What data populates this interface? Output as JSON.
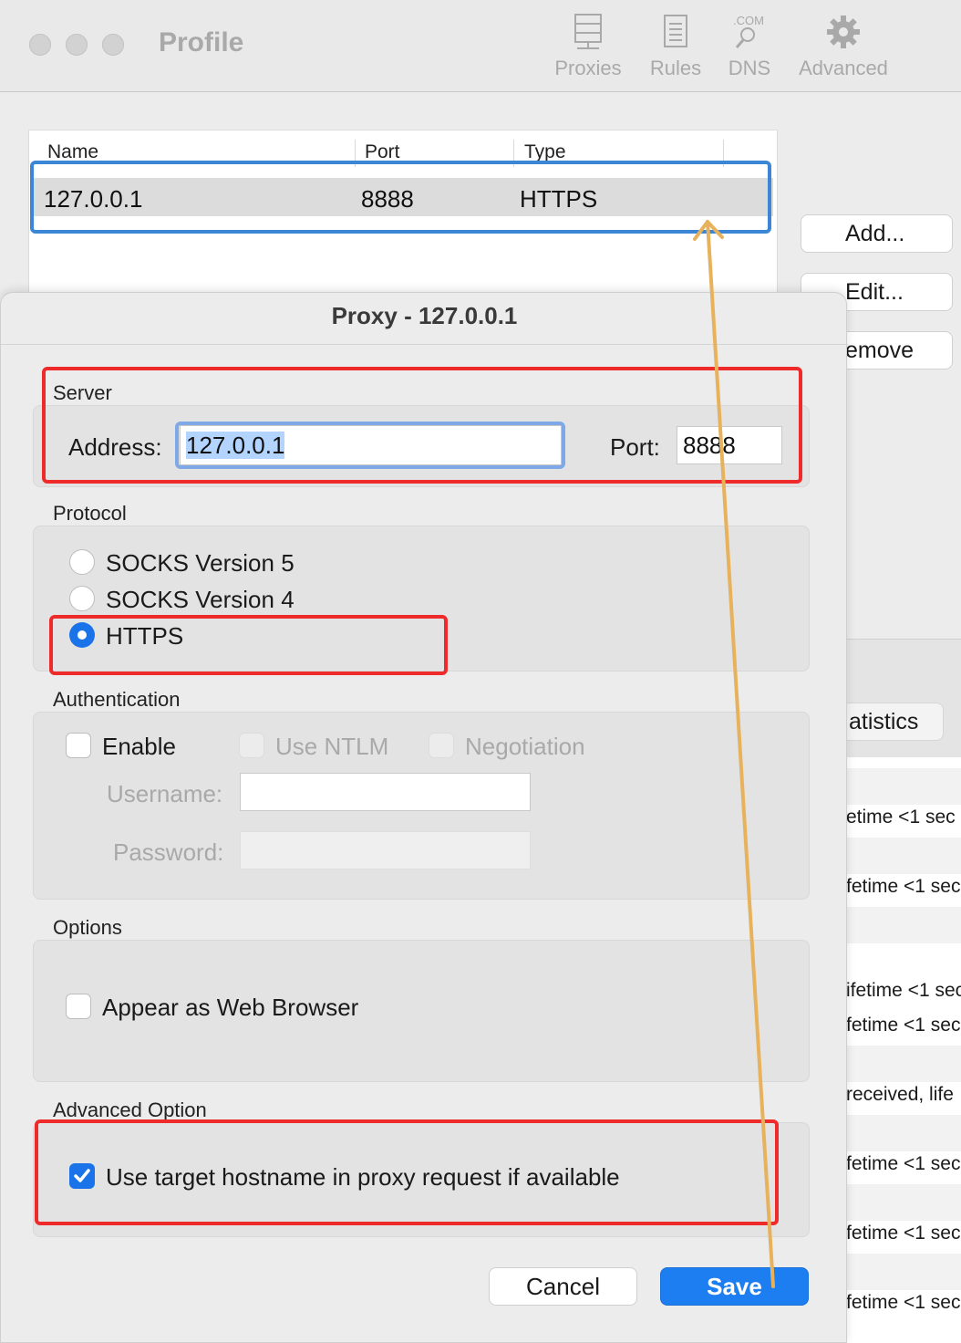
{
  "window": {
    "title": "Profile",
    "toolbar": [
      {
        "label": "Proxies",
        "icon": "server-icon"
      },
      {
        "label": "Rules",
        "icon": "document-list-icon"
      },
      {
        "label": "DNS",
        "icon": "dns-com-icon",
        "icon_text": ".COM"
      },
      {
        "label": "Advanced",
        "icon": "gear-icon"
      }
    ]
  },
  "proxy_table": {
    "columns": [
      "Name",
      "Port",
      "Type"
    ],
    "rows": [
      {
        "name": "127.0.0.1",
        "port": "8888",
        "type": "HTTPS"
      }
    ]
  },
  "side_buttons": {
    "add": "Add...",
    "edit": "Edit...",
    "remove": "emove"
  },
  "background": {
    "tab": "atistics",
    "log_lines": [
      "etime <1 sec",
      "fetime <1 sec",
      "ifetime <1 sec",
      "fetime <1 sec",
      "received, life",
      "fetime <1 sec",
      "fetime <1 sec",
      "fetime <1 sec"
    ]
  },
  "dialog": {
    "title": "Proxy - 127.0.0.1",
    "server": {
      "section": "Server",
      "address_label": "Address:",
      "address_value": "127.0.0.1",
      "port_label": "Port:",
      "port_value": "8888"
    },
    "protocol": {
      "section": "Protocol",
      "options": [
        "SOCKS Version 5",
        "SOCKS Version 4",
        "HTTPS"
      ],
      "selected": "HTTPS"
    },
    "authentication": {
      "section": "Authentication",
      "enable": "Enable",
      "use_ntlm": "Use NTLM",
      "negotiation": "Negotiation",
      "username_label": "Username:",
      "password_label": "Password:",
      "username_value": "",
      "password_value": ""
    },
    "options": {
      "section": "Options",
      "appear_as_browser": "Appear as Web Browser"
    },
    "advanced": {
      "section": "Advanced Option",
      "use_target_hostname": "Use target hostname in proxy request if available",
      "checked": true
    },
    "buttons": {
      "cancel": "Cancel",
      "save": "Save"
    }
  },
  "colors": {
    "accent": "#1c7ef0",
    "annotation_red": "#ee2a2a",
    "annotation_blue": "#3b87d6",
    "annotation_arrow": "#e8b25c"
  }
}
